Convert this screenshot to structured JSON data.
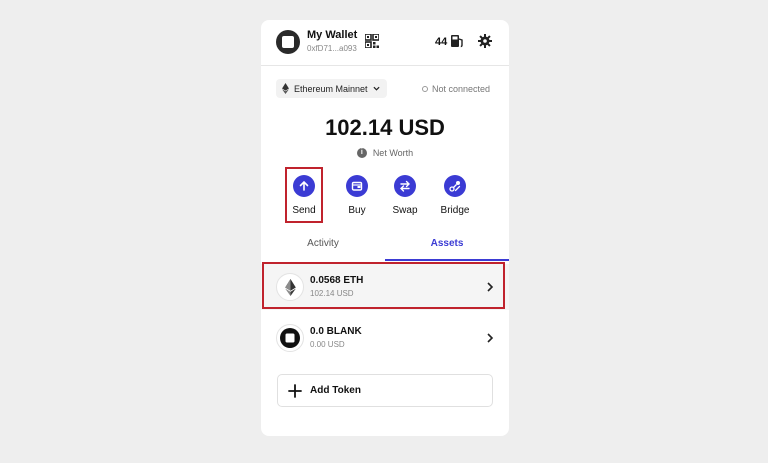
{
  "wallet": {
    "name": "My Wallet",
    "address": "0xfD71...a093",
    "gas_count": "44"
  },
  "network": {
    "selected": "Ethereum Mainnet",
    "connection_status": "Not connected"
  },
  "balance": {
    "total": "102.14 USD",
    "label": "Net Worth"
  },
  "actions": [
    {
      "label": "Send",
      "icon": "arrow-up-icon"
    },
    {
      "label": "Buy",
      "icon": "wallet-icon"
    },
    {
      "label": "Swap",
      "icon": "swap-icon"
    },
    {
      "label": "Bridge",
      "icon": "bridge-icon"
    }
  ],
  "tabs": [
    {
      "label": "Activity",
      "active": false
    },
    {
      "label": "Assets",
      "active": true
    }
  ],
  "assets": [
    {
      "amount": "0.0568 ETH",
      "value": "102.14 USD",
      "icon": "ethereum-icon"
    },
    {
      "amount": "0.0 BLANK",
      "value": "0.00 USD",
      "icon": "blank-token-icon"
    }
  ],
  "add_token_label": "Add Token",
  "colors": {
    "accent": "#3b3bd4",
    "highlight": "#c0232d",
    "background": "#eeeeee"
  }
}
